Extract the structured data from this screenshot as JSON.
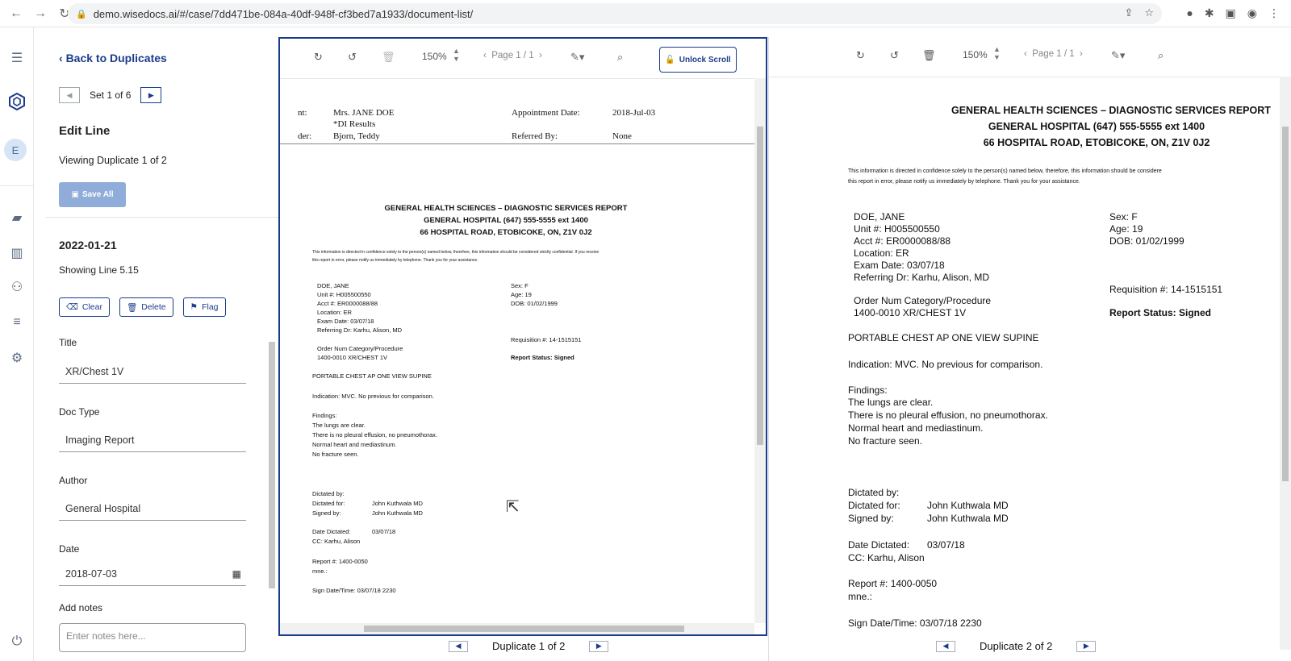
{
  "browser": {
    "url": "demo.wisedocs.ai/#/case/7dd471be-084a-40df-948f-cf3bed7a1933/document-list/"
  },
  "rail": {
    "avatar_initial": "E"
  },
  "panel": {
    "back_label": "Back to Duplicates",
    "set_label": "Set 1 of 6",
    "edit_heading": "Edit Line",
    "viewing_label": "Viewing Duplicate 1 of 2",
    "save_all_label": "Save All",
    "date_heading": "2022-01-21",
    "showing_label": "Showing Line 5.15",
    "clear_label": "Clear",
    "delete_label": "Delete",
    "flag_label": "Flag",
    "fields": {
      "title_label": "Title",
      "title_value": "XR/Chest 1V",
      "doctype_label": "Doc Type",
      "doctype_value": "Imaging Report",
      "author_label": "Author",
      "author_value": "General Hospital",
      "date_label": "Date",
      "date_value": "2018-07-03",
      "notes_label": "Add notes",
      "notes_placeholder": "Enter notes here..."
    }
  },
  "viewer_left": {
    "zoom": "150%",
    "page": "Page 1 / 1",
    "unlock_label": "Unlock Scroll",
    "pager_label": "Duplicate 1 of 2",
    "header": {
      "h1": "nt:",
      "v1": "Mrs. JANE DOE",
      "v1b": "*DI Results",
      "k2": "Appointment Date:",
      "v2": "2018-Jul-03",
      "h3": "der:",
      "v3": "Bjorn, Teddy",
      "k4": "Referred By:",
      "v4": "None"
    }
  },
  "viewer_right": {
    "zoom": "150%",
    "page": "Page 1 / 1",
    "pager_label": "Duplicate 2 of 2"
  },
  "report": {
    "title1": "GENERAL HEALTH SCIENCES – DIAGNOSTIC SERVICES REPORT",
    "title2": "GENERAL HOSPITAL  (647) 555-5555 ext 1400",
    "title3": "66 HOSPITAL ROAD, ETOBICOKE, ON, Z1V 0J2",
    "conf1": "This information is directed in confidence solely to the person(s) named below, therefore, this information should be considered strictly confidential. If you receive",
    "conf2": "this report in error, please notify us immediately by telephone. Thank you for your assistance.",
    "conf1_right": "This information is directed in confidence solely to the person(s) named below, therefore, this information should be considere",
    "patient": "DOE, JANE",
    "unit": "Unit #: H005500550",
    "acct": "Acct #: ER0000088/88",
    "location": "Location: ER",
    "exam_date": "Exam Date: 03/07/18",
    "referring": "Referring Dr: Karhu, Alison, MD",
    "sex": "Sex: F",
    "age": "Age: 19",
    "dob": "DOB: 01/02/1999",
    "requisition": "Requisition #: 14-1515151",
    "order_head": "Order Num   Category/Procedure",
    "order_row": "1400-0010   XR/CHEST 1V",
    "status": "Report Status: Signed",
    "procedure": "PORTABLE CHEST AP ONE VIEW SUPINE",
    "indication": "Indication: MVC. No previous for comparison.",
    "findings": "Findings:",
    "f1": "The lungs are clear.",
    "f2": "There is no pleural effusion, no pneumothorax.",
    "f3": "Normal heart and mediastinum.",
    "f4": "No fracture seen.",
    "dictated_by": "Dictated by:",
    "dictated_for": "Dictated for:",
    "dictated_for_val": "John Kuthwala MD",
    "signed_by": "Signed by:",
    "signed_by_val": "John Kuthwala MD",
    "date_dictated": "Date Dictated:",
    "date_dictated_val": "03/07/18",
    "cc": "CC: Karhu, Alison",
    "report_no": "Report #: 1400-0050",
    "mne": "mne.:",
    "sign_date": "Sign Date/Time: 03/07/18  2230"
  }
}
